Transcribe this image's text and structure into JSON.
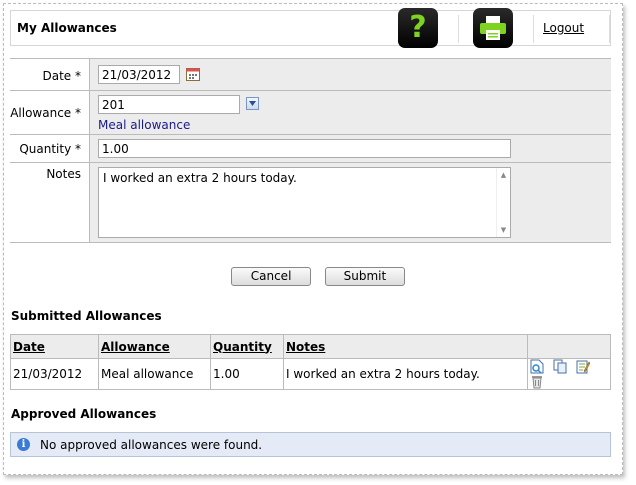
{
  "header": {
    "title": "My Allowances",
    "help_icon": "help-question-icon",
    "print_icon": "printer-icon",
    "logout_label": "Logout"
  },
  "form": {
    "date_label": "Date *",
    "date_value": "21/03/2012",
    "allowance_label": "Allowance *",
    "allowance_value": "201",
    "allowance_name": "Meal allowance",
    "quantity_label": "Quantity *",
    "quantity_value": "1.00",
    "notes_label": "Notes",
    "notes_value": "I worked an extra 2 hours today.",
    "cancel_label": "Cancel",
    "submit_label": "Submit"
  },
  "submitted": {
    "title": "Submitted Allowances",
    "columns": [
      "Date",
      "Allowance",
      "Quantity",
      "Notes"
    ],
    "rows": [
      {
        "date": "21/03/2012",
        "allowance": "Meal allowance",
        "quantity": "1.00",
        "notes": "I worked an extra 2 hours today."
      }
    ]
  },
  "approved": {
    "title": "Approved Allowances",
    "empty_message": "No approved allowances were found."
  },
  "colors": {
    "field_bg": "#ececec",
    "link": "#1a1a8c",
    "info_bg": "#e4ebf6"
  }
}
